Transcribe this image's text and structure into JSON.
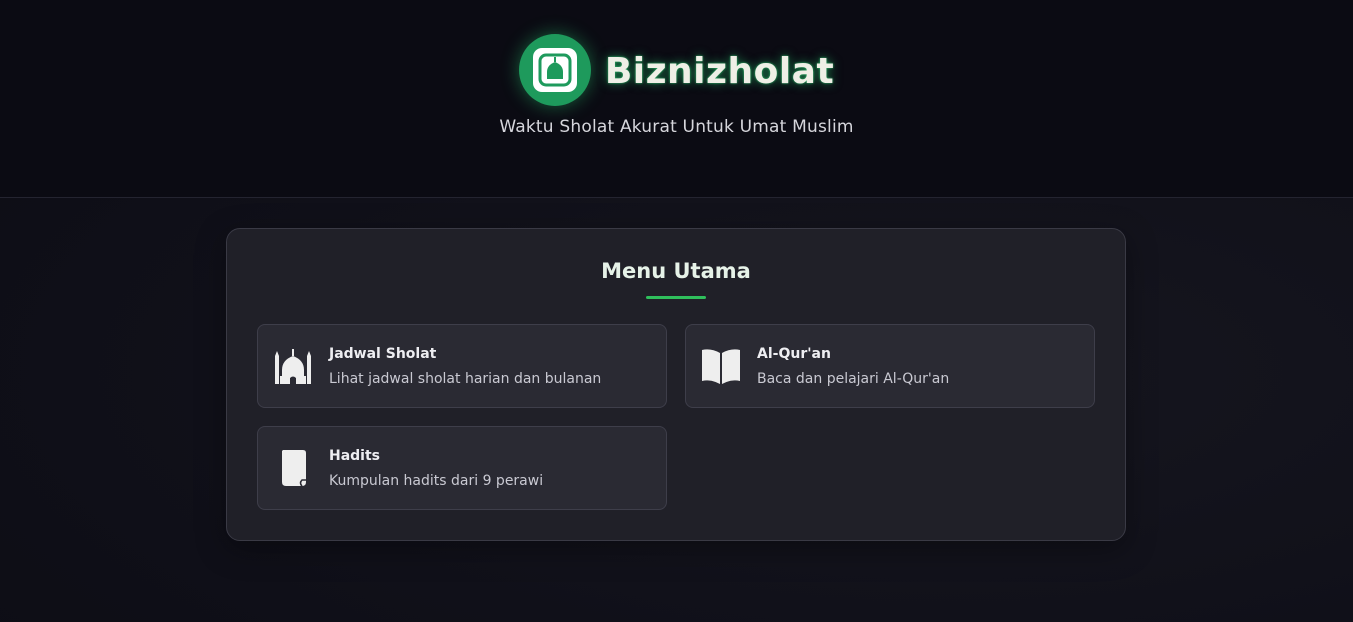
{
  "header": {
    "brand_name": "Biznizholat",
    "tagline": "Waktu Sholat Akurat Untuk Umat Muslim",
    "logo_icon": "mosque-dome-icon",
    "accent_color": "#1e9a5c"
  },
  "main": {
    "title": "Menu Utama",
    "underline_color": "#2fbf5c",
    "items": [
      {
        "label": "Jadwal Sholat",
        "description": "Lihat jadwal sholat harian dan bulanan",
        "icon": "mosque-icon"
      },
      {
        "label": "Al-Qur'an",
        "description": "Baca dan pelajari Al-Qur'an",
        "icon": "open-book-icon"
      },
      {
        "label": "Hadits",
        "description": "Kumpulan hadits dari 9 perawi",
        "icon": "scroll-icon"
      }
    ]
  }
}
